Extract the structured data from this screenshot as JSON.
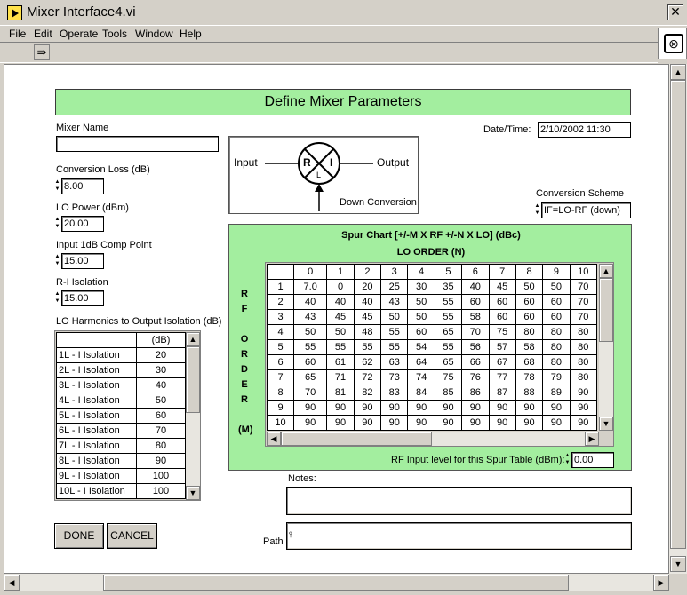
{
  "window": {
    "title": "Mixer Interface4.vi",
    "close_glyph": "✕"
  },
  "menu": [
    "File",
    "Edit",
    "Operate",
    "Tools",
    "Window",
    "Help"
  ],
  "panel": {
    "header": "Define Mixer Parameters",
    "mixer_name": {
      "label": "Mixer Name",
      "value": ""
    },
    "datetime": {
      "label": "Date/Time:",
      "value": "2/10/2002 11:30"
    },
    "conversion_loss": {
      "label": "Conversion Loss (dB)",
      "value": "8.00"
    },
    "lo_power": {
      "label": "LO Power (dBm)",
      "value": "20.00"
    },
    "input_comp": {
      "label": "Input 1dB Comp Point",
      "value": "15.00"
    },
    "ri_isolation": {
      "label": "R-I Isolation",
      "value": "15.00"
    },
    "conversion_scheme": {
      "label": "Conversion Scheme",
      "value": "IF=LO-RF (down)"
    },
    "diagram": {
      "input": "Input",
      "output": "Output",
      "r": "R",
      "i": "I",
      "l": "L",
      "caption": "Down Conversion"
    },
    "lo_harmonics": {
      "label": "LO Harmonics to Output Isolation (dB)",
      "col_header": "(dB)",
      "rows": [
        [
          "1L - I Isolation",
          "20"
        ],
        [
          "2L - I Isolation",
          "30"
        ],
        [
          "3L - I Isolation",
          "40"
        ],
        [
          "4L - I Isolation",
          "50"
        ],
        [
          "5L - I Isolation",
          "60"
        ],
        [
          "6L - I Isolation",
          "70"
        ],
        [
          "7L - I Isolation",
          "80"
        ],
        [
          "8L - I Isolation",
          "90"
        ],
        [
          "9L - I Isolation",
          "100"
        ],
        [
          "10L - I Isolation",
          "100"
        ]
      ]
    },
    "spur": {
      "title": "Spur Chart [+/-M X RF +/-N X LO] (dBc)",
      "lo_order": "LO ORDER (N)",
      "rf_order_letters": [
        "R",
        "F",
        "",
        "O",
        "R",
        "D",
        "E",
        "R",
        "",
        "(M)"
      ],
      "cols": [
        "0",
        "1",
        "2",
        "3",
        "4",
        "5",
        "6",
        "7",
        "8",
        "9",
        "10"
      ],
      "rows": [
        [
          "1",
          [
            "7.0",
            "0",
            "20",
            "25",
            "30",
            "35",
            "40",
            "45",
            "50",
            "50",
            "70"
          ]
        ],
        [
          "2",
          [
            "40",
            "40",
            "40",
            "43",
            "50",
            "55",
            "60",
            "60",
            "60",
            "60",
            "70"
          ]
        ],
        [
          "3",
          [
            "43",
            "45",
            "45",
            "50",
            "50",
            "55",
            "58",
            "60",
            "60",
            "60",
            "70"
          ]
        ],
        [
          "4",
          [
            "50",
            "50",
            "48",
            "55",
            "60",
            "65",
            "70",
            "75",
            "80",
            "80",
            "80"
          ]
        ],
        [
          "5",
          [
            "55",
            "55",
            "55",
            "55",
            "54",
            "55",
            "56",
            "57",
            "58",
            "80",
            "80"
          ]
        ],
        [
          "6",
          [
            "60",
            "61",
            "62",
            "63",
            "64",
            "65",
            "66",
            "67",
            "68",
            "80",
            "80"
          ]
        ],
        [
          "7",
          [
            "65",
            "71",
            "72",
            "73",
            "74",
            "75",
            "76",
            "77",
            "78",
            "79",
            "80"
          ]
        ],
        [
          "8",
          [
            "70",
            "81",
            "82",
            "83",
            "84",
            "85",
            "86",
            "87",
            "88",
            "89",
            "90"
          ]
        ],
        [
          "9",
          [
            "90",
            "90",
            "90",
            "90",
            "90",
            "90",
            "90",
            "90",
            "90",
            "90",
            "90"
          ]
        ],
        [
          "10",
          [
            "90",
            "90",
            "90",
            "90",
            "90",
            "90",
            "90",
            "90",
            "90",
            "90",
            "90"
          ]
        ]
      ],
      "rf_input_label": "RF Input level for this Spur Table  (dBm):",
      "rf_input_value": "0.00"
    },
    "notes": {
      "label": "Notes:",
      "value": ""
    },
    "path": {
      "label": "Path",
      "value": ""
    },
    "done": "DONE",
    "cancel": "CANCEL"
  }
}
